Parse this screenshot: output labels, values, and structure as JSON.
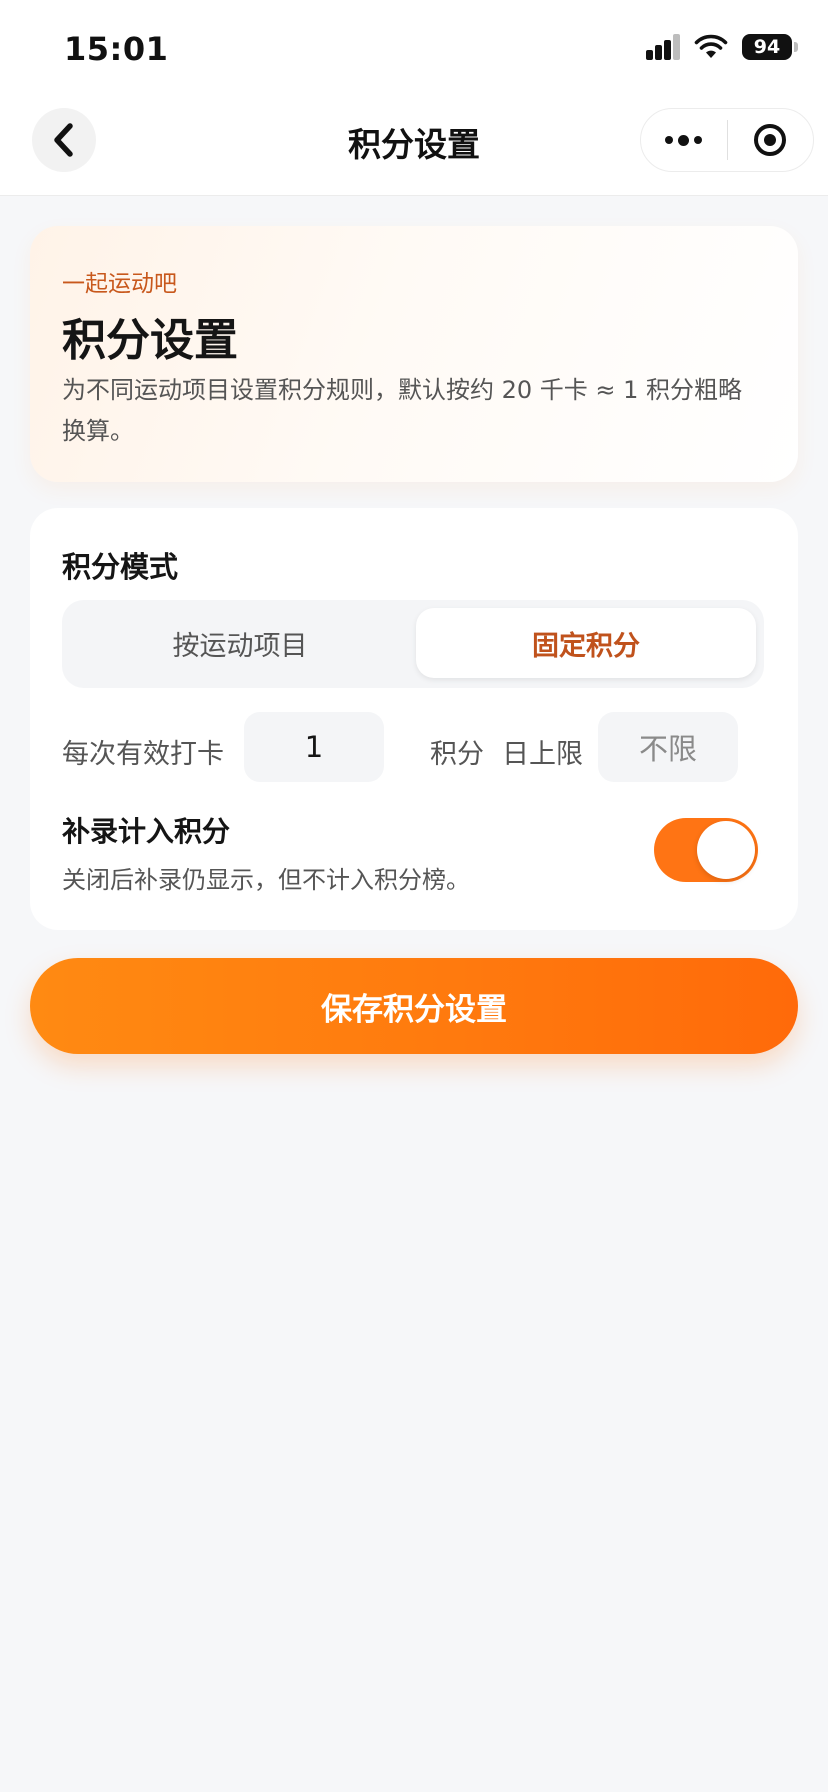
{
  "status_bar": {
    "time": "15:01",
    "battery": "94"
  },
  "nav": {
    "title": "积分设置"
  },
  "hero": {
    "eyebrow": "一起运动吧",
    "title": "积分设置",
    "description": "为不同运动项目设置积分规则，默认按约 20 千卡 ≈ 1 积分粗略换算。"
  },
  "mode": {
    "title": "积分模式",
    "options": [
      "按运动项目",
      "固定积分"
    ],
    "selected": "固定积分"
  },
  "points_row": {
    "per_checkin_label": "每次有效打卡",
    "per_checkin_value": "1",
    "points_unit": "积分",
    "daily_limit_label": "日上限",
    "daily_limit_placeholder": "不限"
  },
  "makeup": {
    "title": "补录计入积分",
    "description": "关闭后补录仍显示，但不计入积分榜。",
    "enabled": true
  },
  "save_button": {
    "label": "保存积分设置"
  },
  "colors": {
    "accent": "#ff7414",
    "accent_text": "#c0521c",
    "background": "#f6f7f9"
  }
}
